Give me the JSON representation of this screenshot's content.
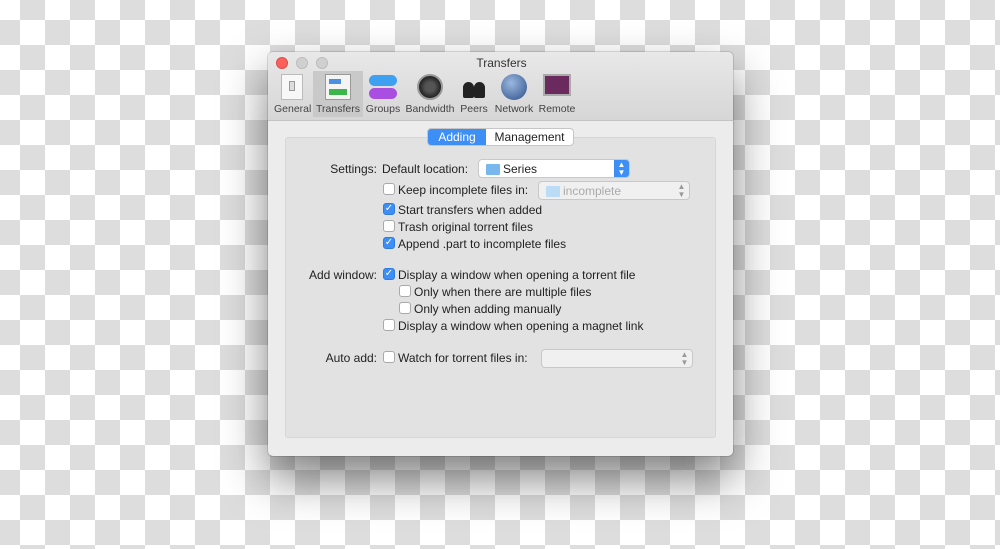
{
  "window": {
    "title": "Transfers"
  },
  "toolbar": {
    "items": [
      {
        "label": "General",
        "icon": "switch-icon"
      },
      {
        "label": "Transfers",
        "icon": "transfers-icon",
        "selected": true
      },
      {
        "label": "Groups",
        "icon": "groups-icon"
      },
      {
        "label": "Bandwidth",
        "icon": "speedometer-icon"
      },
      {
        "label": "Peers",
        "icon": "peers-icon"
      },
      {
        "label": "Network",
        "icon": "globe-icon"
      },
      {
        "label": "Remote",
        "icon": "remote-display-icon"
      }
    ]
  },
  "tabs": {
    "adding": "Adding",
    "management": "Management",
    "selected": "Adding"
  },
  "settings": {
    "label": "Settings:",
    "default_location_label": "Default location:",
    "default_location_value": "Series",
    "keep_incomplete": {
      "label": "Keep incomplete files in:",
      "checked": false,
      "folder": "incomplete"
    },
    "start_transfers": {
      "label": "Start transfers when added",
      "checked": true
    },
    "trash_original": {
      "label": "Trash original torrent files",
      "checked": false
    },
    "append_part": {
      "label": "Append .part to incomplete files",
      "checked": true
    }
  },
  "add_window": {
    "label": "Add window:",
    "display_torrent": {
      "label": "Display a window when opening a torrent file",
      "checked": true
    },
    "only_multiple": {
      "label": "Only when there are multiple files",
      "checked": false
    },
    "only_manual": {
      "label": "Only when adding manually",
      "checked": false
    },
    "display_magnet": {
      "label": "Display a window when opening a magnet link",
      "checked": false
    }
  },
  "auto_add": {
    "label": "Auto add:",
    "watch": {
      "label": "Watch for torrent files in:",
      "checked": false,
      "folder": ""
    }
  },
  "colors": {
    "accent": "#3d8ef5",
    "close": "#fc605c"
  }
}
